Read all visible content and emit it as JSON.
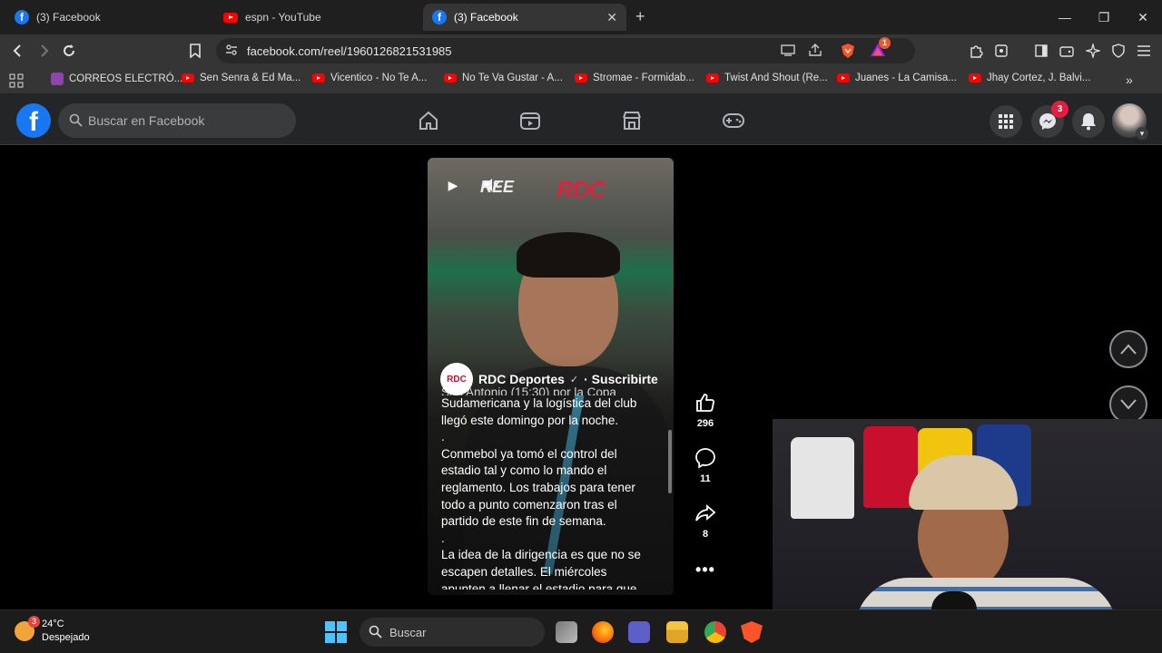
{
  "browser": {
    "tabs": [
      {
        "title": "(3) Facebook",
        "icon": "facebook"
      },
      {
        "title": "espn - YouTube",
        "icon": "youtube"
      },
      {
        "title": "(3) Facebook",
        "icon": "facebook",
        "active": true
      }
    ],
    "new_tab": "+",
    "url": "facebook.com/reel/1960126821531985",
    "brave_badge": "1",
    "bookmarks": [
      {
        "label": "CORREOS ELECTRÓ...",
        "icon": "list"
      },
      {
        "label": "Sen Senra & Ed Ma...",
        "icon": "youtube"
      },
      {
        "label": "Vicentico - No Te A...",
        "icon": "youtube"
      },
      {
        "label": "No Te Va Gustar - A...",
        "icon": "youtube"
      },
      {
        "label": "Stromae - Formidab...",
        "icon": "youtube"
      },
      {
        "label": "Twist And Shout (Re...",
        "icon": "youtube"
      },
      {
        "label": "Juanes - La Camisa...",
        "icon": "youtube"
      },
      {
        "label": "Jhay Cortez, J. Balvi...",
        "icon": "youtube"
      }
    ]
  },
  "facebook": {
    "logo": "f",
    "search_placeholder": "Buscar en Facebook",
    "messenger_badge": "3",
    "colors": {
      "brand": "#1877f2",
      "header_bg": "#242526",
      "badge": "#e41e3f"
    }
  },
  "reel": {
    "logo_main": "RDC",
    "logo_secondary": "REE",
    "author": "RDC Deportes",
    "subscribe": "· Suscribirte",
    "avatar_text": "RDC",
    "caption_lines": [
      "San Antonio (15:30) por la Copa",
      "Sudamericana y la logística del club",
      "llegó este domingo por la noche.",
      ".",
      "Conmebol ya tomó el control del",
      "estadio tal y como lo mando el",
      "reglamento. Los trabajos para tener",
      "todo a punto comenzaron tras el",
      "partido de este fin de semana.",
      ".",
      "La idea de la dirigencia es que no se",
      "escapen detalles. El miércoles",
      "apunten a llenar el estadio para que"
    ],
    "likes": "296",
    "comments": "11",
    "shares": "8"
  },
  "taskbar": {
    "temperature": "24°C",
    "weather": "Despejado",
    "weather_badge": "3",
    "search_placeholder": "Buscar"
  }
}
